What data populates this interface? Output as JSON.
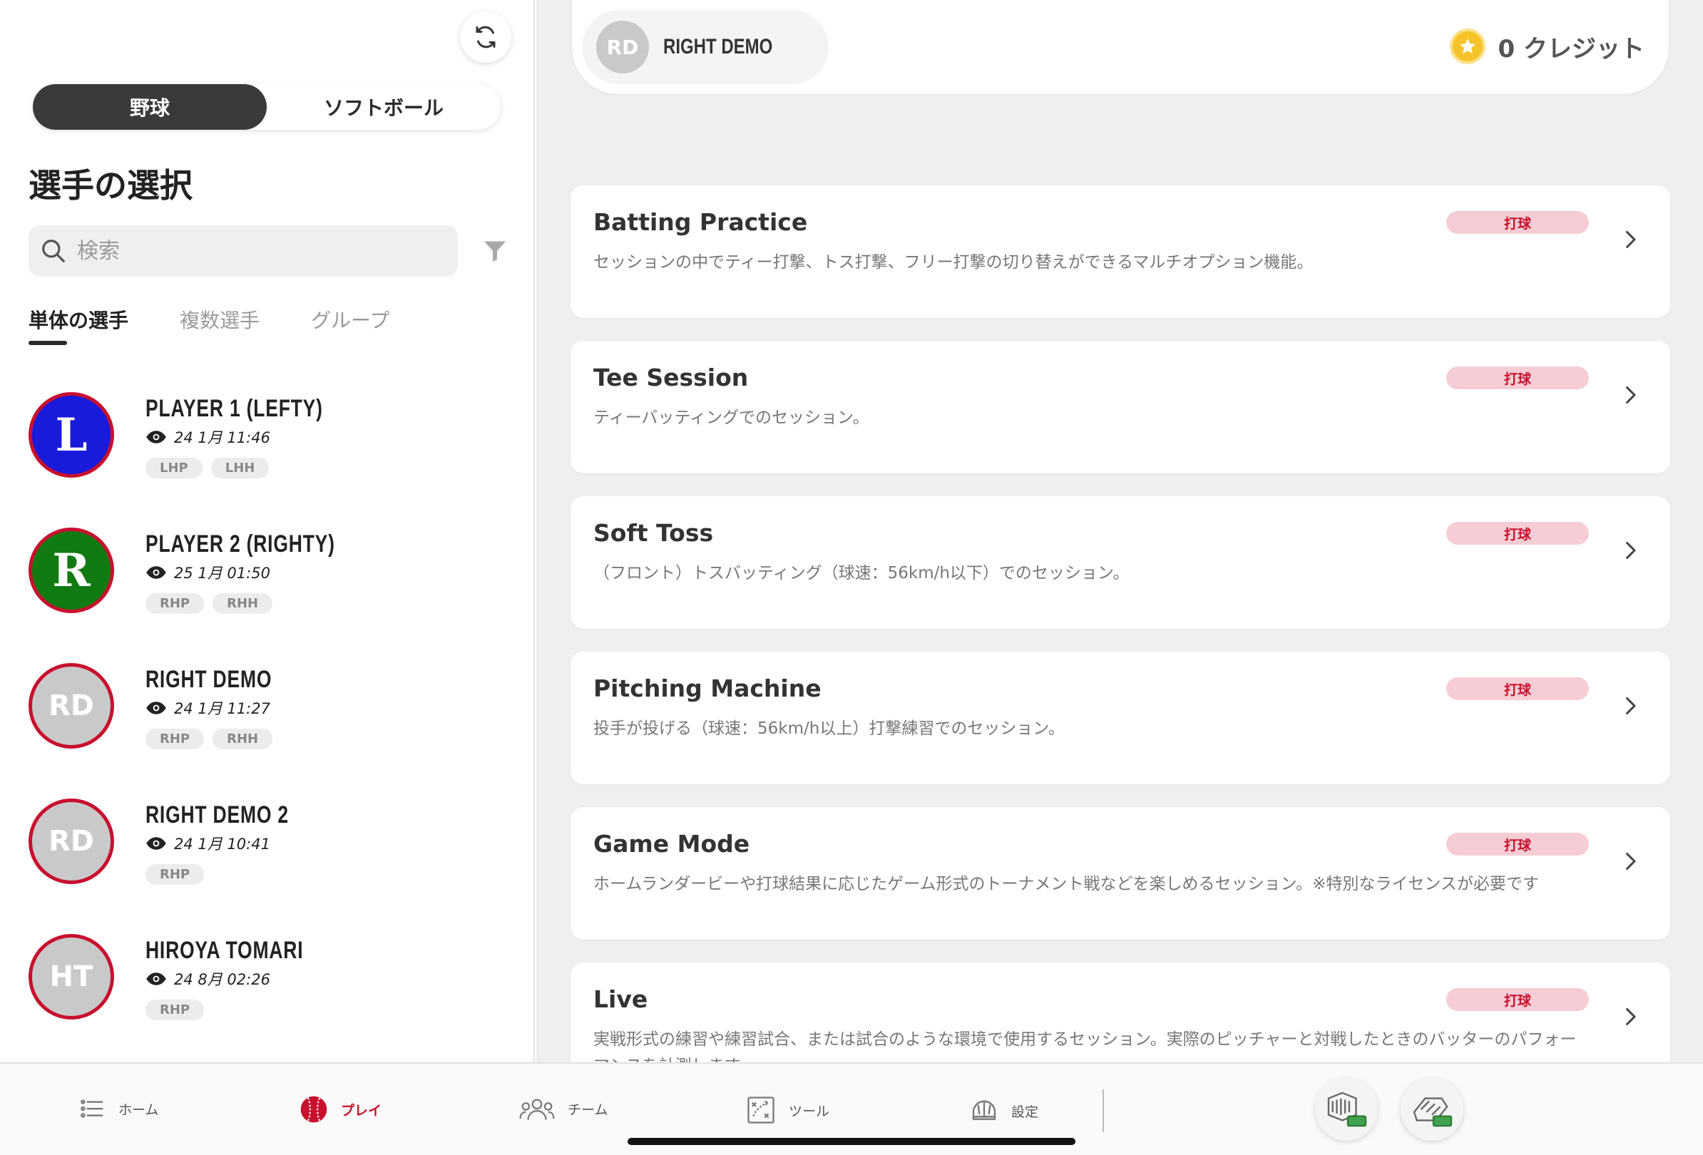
{
  "sport_toggle": {
    "baseball": "野球",
    "softball": "ソフトボール",
    "selected": "baseball"
  },
  "page_title": "選手の選択",
  "search": {
    "placeholder": "検索"
  },
  "player_tabs": [
    "単体の選手",
    "複数選手",
    "グループ"
  ],
  "players": [
    {
      "name": "PLAYER 1 (LEFTY)",
      "initials": "L",
      "date": "24 1月 11:46",
      "badges": [
        "LHP",
        "LHH"
      ],
      "avatar_color": "#1a1adb"
    },
    {
      "name": "PLAYER 2 (RIGHTY)",
      "initials": "R",
      "date": "25 1月 01:50",
      "badges": [
        "RHP",
        "RHH"
      ],
      "avatar_color": "#127a12"
    },
    {
      "name": "RIGHT DEMO",
      "initials": "RD",
      "date": "24 1月 11:27",
      "badges": [
        "RHP",
        "RHH"
      ],
      "avatar_color": "#c9c9c9"
    },
    {
      "name": "RIGHT DEMO 2",
      "initials": "RD",
      "date": "24 1月 10:41",
      "badges": [
        "RHP"
      ],
      "avatar_color": "#c9c9c9"
    },
    {
      "name": "HIROYA TOMARI",
      "initials": "HT",
      "date": "24 8月 02:26",
      "badges": [
        "RHP"
      ],
      "avatar_color": "#c9c9c9"
    }
  ],
  "header": {
    "player_initials": "RD",
    "player_name": "RIGHT DEMO",
    "credits": "0 クレジット"
  },
  "sessions": [
    {
      "title": "Batting Practice",
      "tag": "打球",
      "description": "セッションの中でティー打撃、トス打撃、フリー打撃の切り替えができるマルチオプション機能。"
    },
    {
      "title": "Tee Session",
      "tag": "打球",
      "description": "ティーバッティングでのセッション。"
    },
    {
      "title": "Soft Toss",
      "tag": "打球",
      "description": "（フロント）トスバッティング（球速：56km/h以下）でのセッション。"
    },
    {
      "title": "Pitching Machine",
      "tag": "打球",
      "description": "投手が投げる（球速：56km/h以上）打撃練習でのセッション。"
    },
    {
      "title": "Game Mode",
      "tag": "打球",
      "description": "ホームランダービーや打球結果に応じたゲーム形式のトーナメント戦などを楽しめるセッション。※特別なライセンスが必要です"
    },
    {
      "title": "Live",
      "tag": "打球",
      "description": "実戦形式の練習や練習試合、または試合のような環境で使用するセッション。実際のピッチャーと対戦したときのバッターのパフォーマンスを計測します。"
    }
  ],
  "bottom_nav": [
    {
      "label": "ホーム",
      "icon": "list-icon"
    },
    {
      "label": "プレイ",
      "icon": "baseball-icon",
      "active": true
    },
    {
      "label": "チーム",
      "icon": "team-icon"
    },
    {
      "label": "ツール",
      "icon": "tactics-icon"
    },
    {
      "label": "設定",
      "icon": "helmet-icon"
    }
  ],
  "colors": {
    "accent": "#c8102e",
    "tag_bg": "#f6cdd4",
    "coin": "#f6c42a"
  }
}
